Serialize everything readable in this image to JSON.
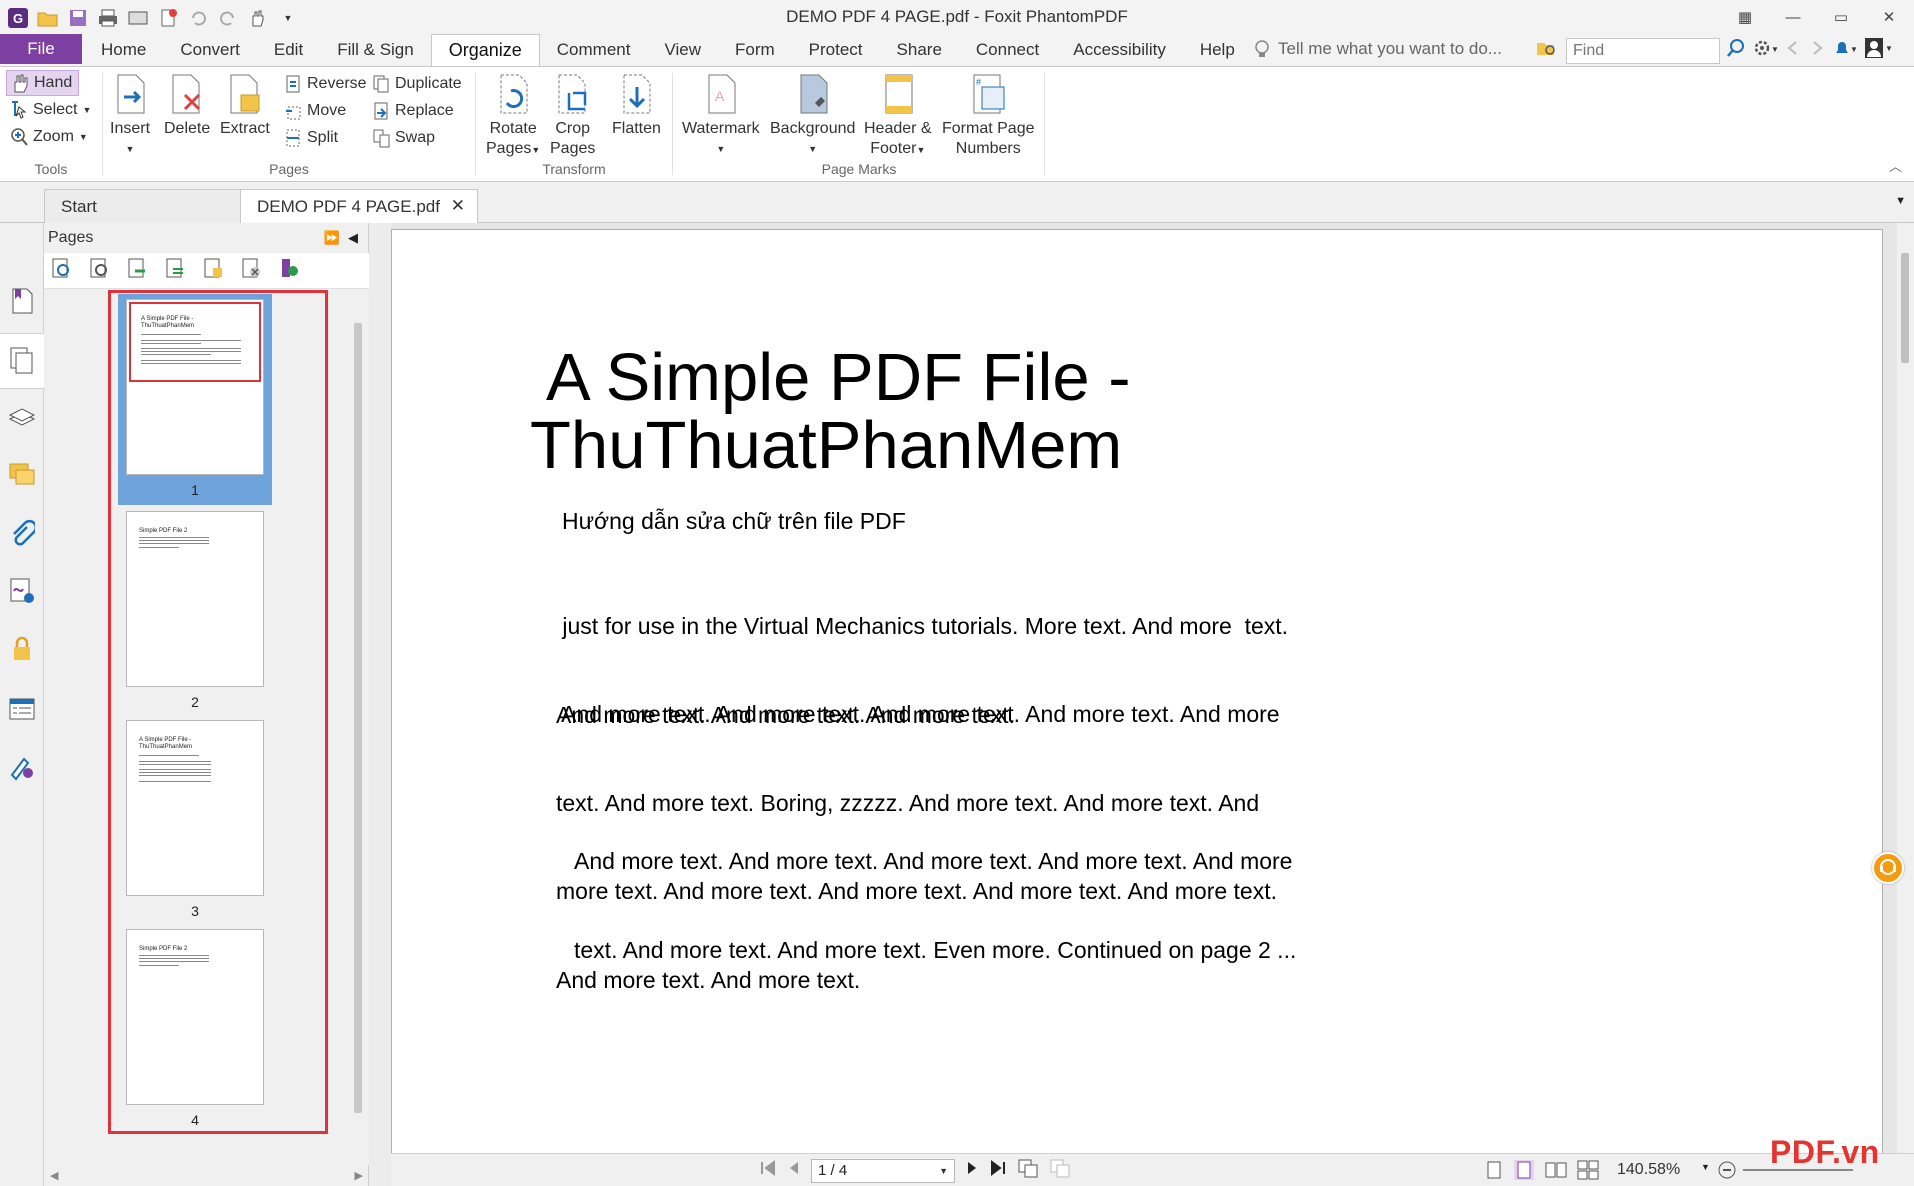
{
  "window": {
    "title": "DEMO PDF 4 PAGE.pdf - Foxit PhantomPDF"
  },
  "menu": {
    "file": "File",
    "tabs": [
      "Home",
      "Convert",
      "Edit",
      "Fill & Sign",
      "Organize",
      "Comment",
      "View",
      "Form",
      "Protect",
      "Share",
      "Connect",
      "Accessibility",
      "Help"
    ],
    "active_tab": "Organize",
    "tell_me": "Tell me what you want to do...",
    "find_placeholder": "Find"
  },
  "ribbon": {
    "tools": {
      "hand": "Hand",
      "select": "Select",
      "zoom": "Zoom",
      "label": "Tools"
    },
    "pages": {
      "insert": "Insert",
      "delete": "Delete",
      "extract": "Extract",
      "reverse": "Reverse",
      "move": "Move",
      "split": "Split",
      "duplicate": "Duplicate",
      "replace": "Replace",
      "swap": "Swap",
      "label": "Pages"
    },
    "transform": {
      "rotate_line1": "Rotate",
      "rotate_line2": "Pages",
      "crop_line1": "Crop",
      "crop_line2": "Pages",
      "flatten": "Flatten",
      "label": "Transform"
    },
    "page_marks": {
      "watermark": "Watermark",
      "background": "Background",
      "header_line1": "Header &",
      "header_line2": "Footer",
      "format_line1": "Format Page",
      "format_line2": "Numbers",
      "label": "Page Marks"
    }
  },
  "doc_tabs": {
    "start": "Start",
    "current": "DEMO PDF 4 PAGE.pdf"
  },
  "pages_panel": {
    "title": "Pages",
    "thumbnails": [
      {
        "num": "1",
        "title": "A Simple PDF File -\nThuThuatPhanMem"
      },
      {
        "num": "2",
        "title": "Simple PDF File 2"
      },
      {
        "num": "3",
        "title": "A Simple PDF File -\nThuThuatPhanMem"
      },
      {
        "num": "4",
        "title": "Simple PDF File 2"
      }
    ]
  },
  "document": {
    "title_line1": "A Simple PDF File -",
    "title_line2": "ThuThuatPhanMem",
    "subtitle": "Hướng dẫn sửa chữ trên file PDF",
    "para1": [
      " just for use in the Virtual Mechanics tutorials. More text. And more  text.",
      "And more text. And more text. And more text."
    ],
    "para2": [
      " And more text. And more text. And more text. And more text. And more",
      "text. And more text. Boring, zzzzz. And more text. And more text. And",
      "more text. And more text. And more text. And more text. And more text.",
      "And more text. And more text."
    ],
    "para3": [
      "And more text. And more text. And more text. And more text. And more",
      "text. And more text. And more text. Even more. Continued on page 2 ..."
    ]
  },
  "status": {
    "page": "1 / 4",
    "zoom": "140.58%"
  },
  "branding": {
    "logo": "PDF.vn"
  },
  "colors": {
    "accent": "#7d3fa2",
    "selection": "#6fa3dc",
    "highlight_box": "#e0323a"
  }
}
